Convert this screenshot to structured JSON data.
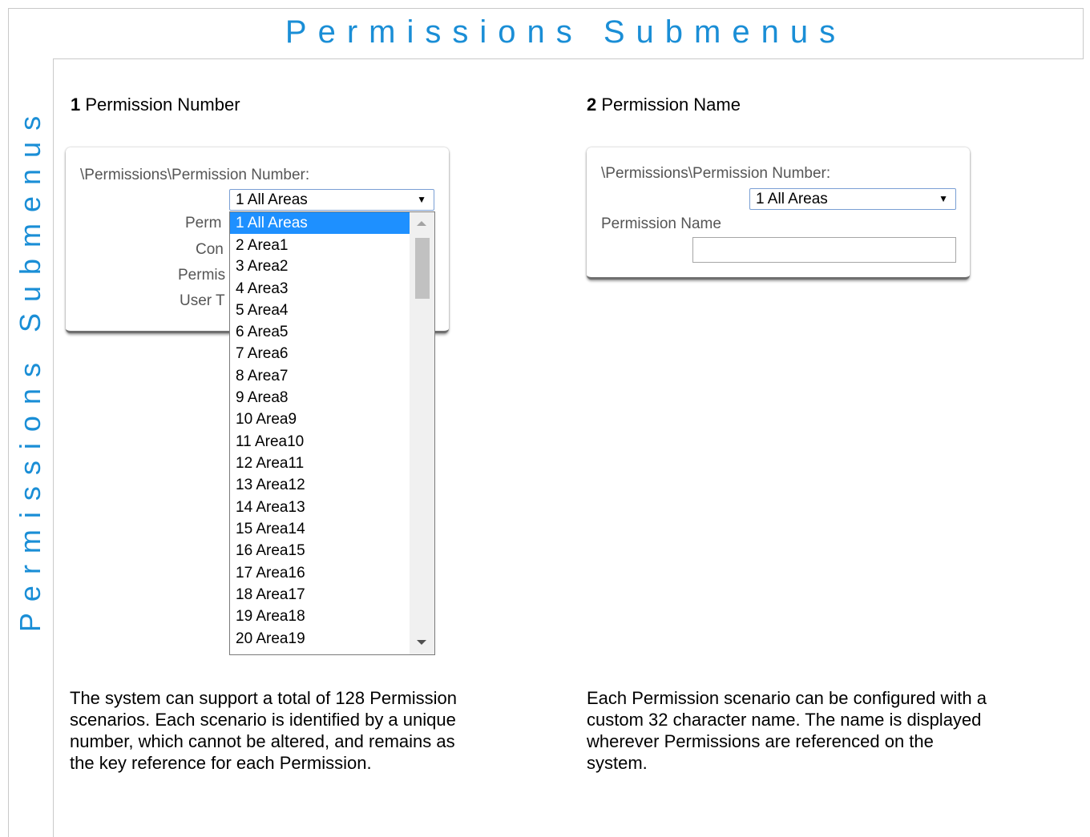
{
  "page_title": "Permissions Submenus",
  "side_title": "Permissions Submenus",
  "section1": {
    "number": "1",
    "heading": "Permission Number",
    "panel_label": "\\Permissions\\Permission Number:",
    "select_value": "1 All Areas",
    "select_arrow": "▼",
    "hidden_labels": [
      "Perm",
      "Con",
      "Permis",
      "User T"
    ],
    "dropdown_options": [
      "1 All Areas",
      "2 Area1",
      "3 Area2",
      "4 Area3",
      "5 Area4",
      "6 Area5",
      "7 Area6",
      "8 Area7",
      "9 Area8",
      "10 Area9",
      "11 Area10",
      "12 Area11",
      "13 Area12",
      "14 Area13",
      "15 Area14",
      "16 Area15",
      "17 Area16",
      "18 Area17",
      "19 Area18",
      "20 Area19"
    ],
    "description_lines": [
      "The system can support a total of 128 Permission",
      "scenarios. Each scenario is identified by a unique",
      "number, which cannot be altered, and remains as",
      "the key reference for each Permission."
    ]
  },
  "section2": {
    "number": "2",
    "heading": "Permission Name",
    "panel_label": "\\Permissions\\Permission Number:",
    "select_value": "1 All Areas",
    "select_arrow": "▼",
    "name_label": "Permission Name",
    "name_value": "",
    "description_lines": [
      "Each Permission scenario can be configured with a",
      "custom 32 character name. The name is displayed",
      "wherever Permissions are referenced on the",
      "system."
    ]
  },
  "colors": {
    "accent": "#1a8ed6",
    "selected": "#1e90ff"
  }
}
